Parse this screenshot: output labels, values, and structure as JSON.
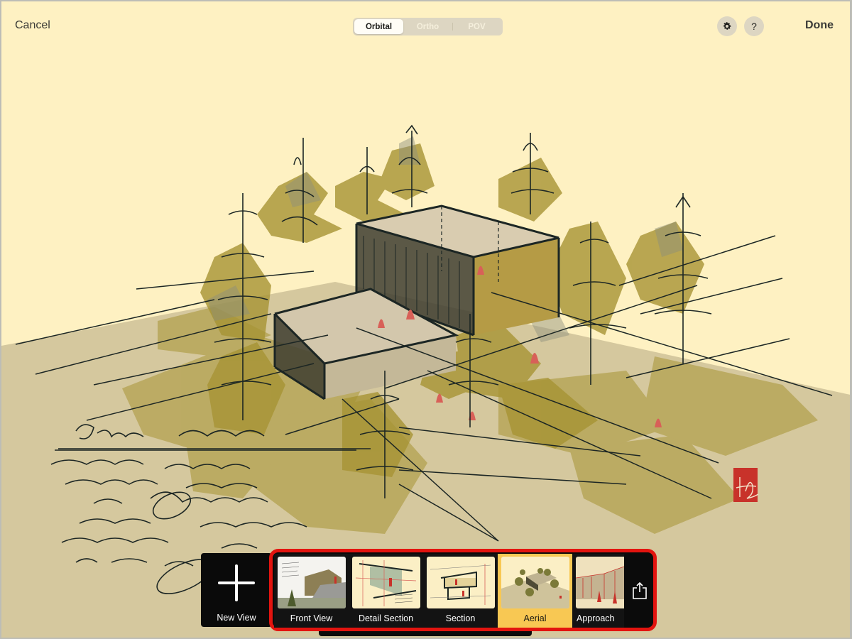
{
  "toolbar": {
    "cancel_label": "Cancel",
    "done_label": "Done",
    "view_modes": [
      {
        "label": "Orbital",
        "selected": true
      },
      {
        "label": "Ortho",
        "selected": false
      },
      {
        "label": "POV",
        "selected": false
      }
    ],
    "settings_icon": "gear-icon",
    "help_label": "?"
  },
  "canvas": {
    "subject": "Aerial sketch of a modern two-volume building with pine trees",
    "colors": {
      "paper": "#fef1c2",
      "ground": "#d5c89e",
      "foliage": "#a79434",
      "shadow": "#857f5a",
      "ink": "#1c2624",
      "accent_red": "#d86058",
      "stamp_red": "#c8322a"
    }
  },
  "views_strip": {
    "new_view_label": "New View",
    "views": [
      {
        "label": "Front View",
        "selected": false
      },
      {
        "label": "Detail Section",
        "selected": false
      },
      {
        "label": "Section",
        "selected": false
      },
      {
        "label": "Aerial",
        "selected": true
      },
      {
        "label": "Approach",
        "selected": false
      }
    ],
    "share_icon": "share-icon",
    "highlight_color": "#e3140f",
    "selected_color": "#f8c853"
  }
}
